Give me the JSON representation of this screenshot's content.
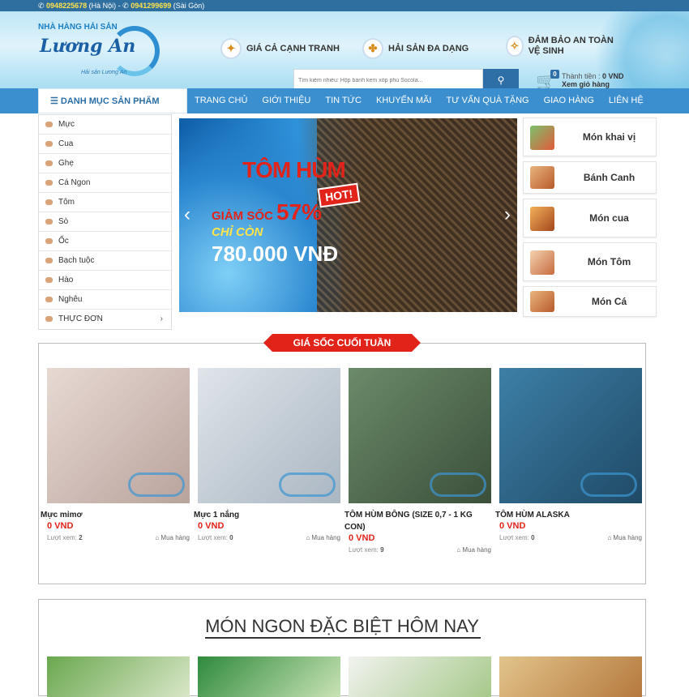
{
  "topbar": {
    "phone1": "0948225678",
    "loc1": "(Hà Nội) -",
    "phone2": "0941299699",
    "loc2": "(Sài Gòn)"
  },
  "logo": {
    "line1": "NHÀ HÀNG HẢI SẢN",
    "line2": "Lương An",
    "line3": "Hải sản Lương An"
  },
  "features": [
    "GIÁ CẢ CẠNH TRANH",
    "HẢI SẢN ĐA DẠNG",
    "ĐẢM BẢO AN TOÀN VỆ SINH"
  ],
  "search": {
    "placeholder": "Tìm kiếm nhiều: Hộp bánh kem xốp phủ Socola..."
  },
  "cart": {
    "count": "0",
    "total_label": "Thành tiền :",
    "total": "0 VND",
    "view": "Xem giỏ hàng"
  },
  "nav": {
    "category_button": "DANH MỤC SẢN PHẨM",
    "items": [
      "TRANG CHỦ",
      "GIỚI THIỆU",
      "TIN TỨC",
      "KHUYẾN MÃI",
      "TƯ VẤN QUÀ TẶNG",
      "GIAO HÀNG",
      "LIÊN HỆ"
    ]
  },
  "categories": [
    "Mực",
    "Cua",
    "Ghẹ",
    "Cá Ngon",
    "Tôm",
    "Sò",
    "Ốc",
    "Bạch tuộc",
    "Hào",
    "Nghêu",
    "THỰC ĐƠN"
  ],
  "banner": {
    "title": "TÔM HÙM",
    "hot": "HOT!",
    "discount_label": "GIẢM SỐC",
    "discount": "57%",
    "only": "CHỈ CÒN",
    "price": "780.000 VNĐ"
  },
  "right_categories": [
    "Món khai vị",
    "Bánh Canh",
    "Món cua",
    "Món Tôm",
    "Món Cá"
  ],
  "sale": {
    "title": "GIÁ SỐC CUỐI TUẦN",
    "products": [
      {
        "name": "Mực mỉmơ",
        "price": "0 VND",
        "views_label": "Lượt xem:",
        "views": "2",
        "buy": "Mua hàng"
      },
      {
        "name": "Mực 1 nắng",
        "price": "0 VND",
        "views_label": "Lượt xem:",
        "views": "0",
        "buy": "Mua hàng"
      },
      {
        "name": "TÔM HÙM BÔNG (SIZE 0,7 - 1 KG CON)",
        "price": "0 VND",
        "views_label": "Lượt xem:",
        "views": "9",
        "buy": "Mua hàng"
      },
      {
        "name": "TÔM HÙM ALASKA",
        "price": "0 VND",
        "views_label": "Lượt xem:",
        "views": "0",
        "buy": "Mua hàng"
      }
    ]
  },
  "special": {
    "title": "MÓN NGON ĐẶC BIỆT HÔM NAY"
  }
}
